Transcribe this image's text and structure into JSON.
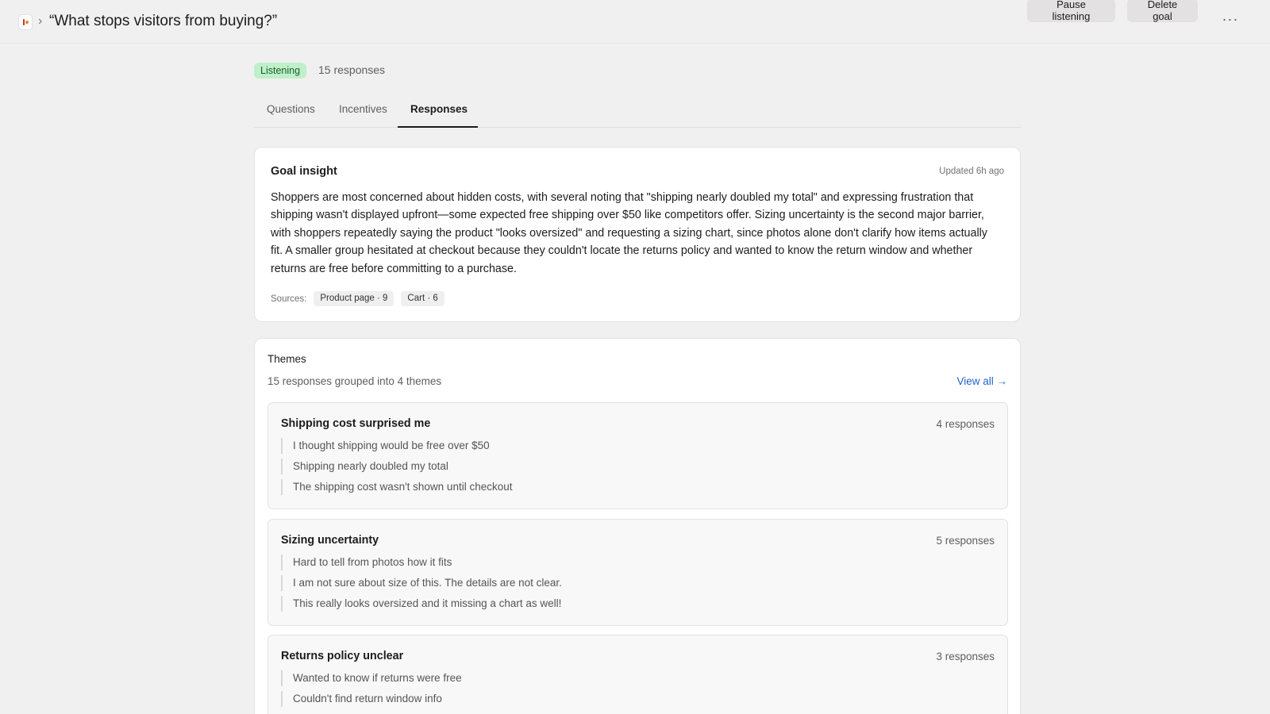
{
  "header": {
    "breadcrumb_sep": "›",
    "title": "“What stops visitors from buying?”",
    "pause_label": "Pause listening",
    "delete_label": "Delete goal",
    "more_glyph": "···"
  },
  "status": {
    "badge": "Listening",
    "responses": "15 responses"
  },
  "tabs": [
    {
      "label": "Questions",
      "active": false
    },
    {
      "label": "Incentives",
      "active": false
    },
    {
      "label": "Responses",
      "active": true
    }
  ],
  "insight": {
    "title": "Goal insight",
    "updated": "Updated 6h ago",
    "body": "Shoppers are most concerned about hidden costs, with several noting that \"shipping nearly doubled my total\" and expressing frustration that shipping wasn't displayed upfront—some expected free shipping over $50 like competitors offer. Sizing uncertainty is the second major barrier, with shoppers repeatedly saying the product \"looks oversized\" and requesting a sizing chart, since photos alone don't clarify how items actually fit. A smaller group hesitated at checkout because they couldn't locate the returns policy and wanted to know the return window and whether returns are free before committing to a purchase.",
    "sources_label": "Sources:",
    "sources": [
      "Product page · 9",
      "Cart · 6"
    ]
  },
  "themes": {
    "title": "Themes",
    "subtitle": "15 responses grouped into 4 themes",
    "view_all": "View all →",
    "items": [
      {
        "title": "Shipping cost surprised me",
        "count": "4 responses",
        "quotes": [
          "I thought shipping would be free over $50",
          "Shipping nearly doubled my total",
          "The shipping cost wasn't shown until checkout"
        ]
      },
      {
        "title": "Sizing uncertainty",
        "count": "5 responses",
        "quotes": [
          "Hard to tell from photos how it fits",
          "I am not sure about size of this. The details are not clear.",
          "This really looks oversized and it missing a chart as well!"
        ]
      },
      {
        "title": "Returns policy unclear",
        "count": "3 responses",
        "quotes": [
          "Wanted to know if returns were free",
          "Couldn't find return window info"
        ]
      }
    ]
  },
  "colors": {
    "background": "#f1f0f0",
    "badge_bg": "#bff0c9",
    "link": "#2563c9"
  }
}
